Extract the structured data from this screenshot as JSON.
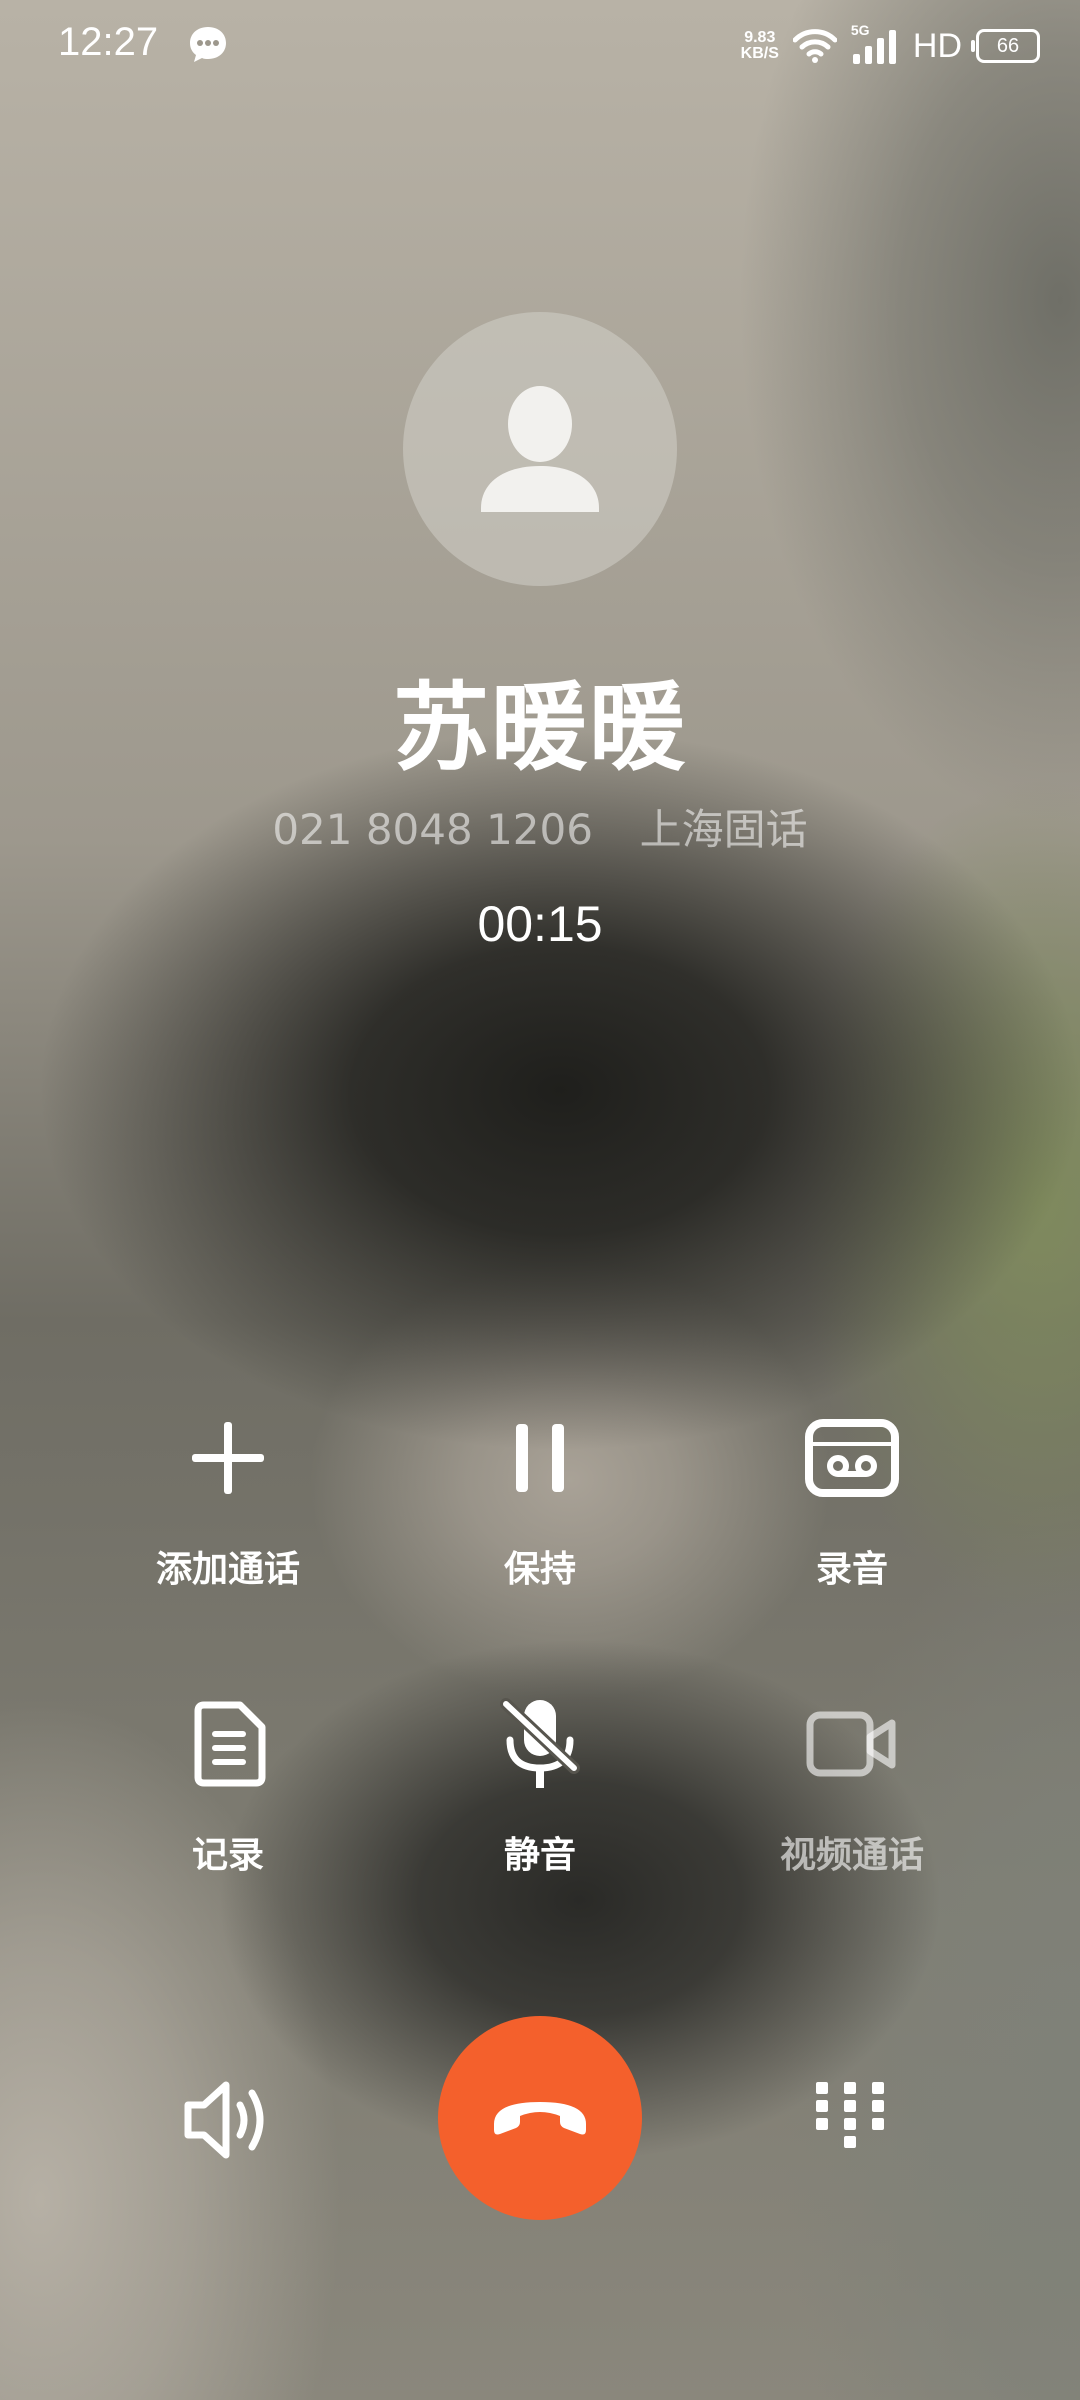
{
  "status_bar": {
    "time": "12:27",
    "net_speed_value": "9.83",
    "net_speed_unit": "KB/S",
    "network": "5G",
    "hd": "HD",
    "battery": "66"
  },
  "caller": {
    "name": "苏暖暖",
    "number": "021 8048 1206",
    "location": "上海固话",
    "duration": "00:15"
  },
  "actions": [
    {
      "label": "添加通话",
      "icon": "plus-icon"
    },
    {
      "label": "保持",
      "icon": "pause-icon"
    },
    {
      "label": "录音",
      "icon": "record-icon"
    },
    {
      "label": "记录",
      "icon": "note-icon"
    },
    {
      "label": "静音",
      "icon": "mute-mic-icon"
    },
    {
      "label": "视频通话",
      "icon": "video-icon",
      "disabled": true
    }
  ],
  "bottom": {
    "speaker_icon": "speaker-icon",
    "hangup_icon": "hangup-icon",
    "dialpad_icon": "dialpad-icon",
    "hangup_color": "#f4602c"
  }
}
